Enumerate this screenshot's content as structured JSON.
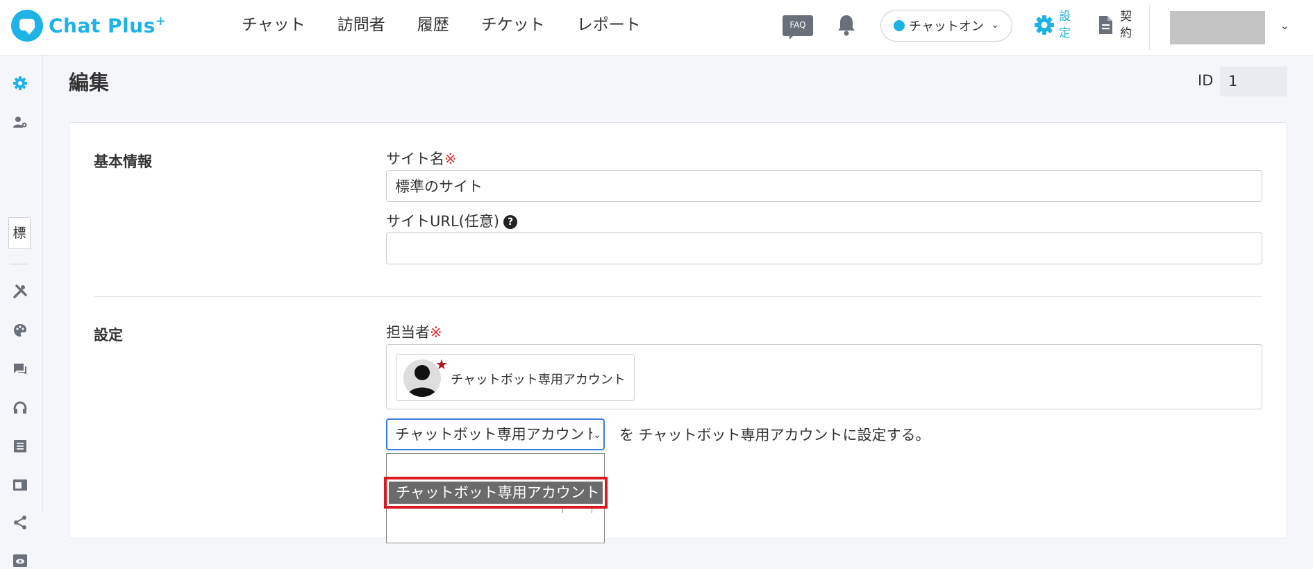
{
  "header": {
    "logo_text": "Chat Plus",
    "logo_sup": "+",
    "nav": [
      "チャット",
      "訪問者",
      "履歴",
      "チケット",
      "レポート"
    ],
    "faq_label": "FAQ",
    "status": "チャットオン",
    "settings_label": "設定",
    "contract_label": "契約"
  },
  "sidebar": {
    "site_char": "標"
  },
  "page": {
    "title": "編集",
    "id_label": "ID",
    "id_value": "1"
  },
  "basic": {
    "section_title": "基本情報",
    "site_name_label": "サイト名",
    "required_mark": "※",
    "site_name_value": "標準のサイト",
    "site_url_label": "サイトURL(任意)",
    "help_icon": "?",
    "site_url_value": ""
  },
  "settings": {
    "section_title": "設定",
    "assignee_label": "担当者",
    "required_mark": "※",
    "chip_label": "チャットボット専用アカウント",
    "select_value": "チャットボット専用アカウント",
    "select_suffix": "を チャットボット専用アカウントに設定する。",
    "dropdown_option": "チャットボット専用アカウント"
  },
  "colors": {
    "brand": "#1db3e6",
    "required": "#d0312d",
    "highlight_border": "#d71b20"
  }
}
